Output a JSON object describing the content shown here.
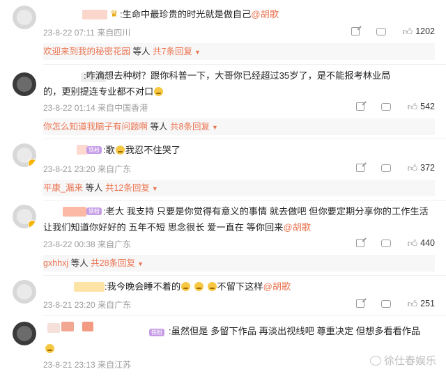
{
  "comments": [
    {
      "text": ":生命中最珍贵的时光就是做自己",
      "mention": "@胡歌",
      "date": "23-8-22 07:11",
      "location": "来自四川",
      "likes": "1202",
      "reply_user": "欢迎来到我的秘密花园",
      "reply_mid": "等人",
      "reply_count": "共7条回复"
    },
    {
      "text_line1": ":咋滴想去种树？跟你科普一下，大哥你已经超过35岁了，是不能报考林业局",
      "text_line2": "的，更别提连专业都不对口",
      "date": "23-8-22 01:14",
      "location": "来自中国香港",
      "likes": "542",
      "reply_user": "你怎么知道我脑子有问题啊",
      "reply_mid": "等人",
      "reply_count": "共8条回复"
    },
    {
      "text_a": ":歌",
      "text_b": "我忍不住哭了",
      "date": "23-8-21 23:20",
      "location": "来自广东",
      "likes": "372",
      "reply_user": "平康_漏来",
      "reply_mid": "等人",
      "reply_count": "共12条回复"
    },
    {
      "text_line1": ":老大 我支持 只要是你觉得有意义的事情 就去做吧 但你要定期分享你的工作生活",
      "text_line2": "让我们知道你好好的  五年不短 思念很长 爱一直在 等你回来",
      "mention": "@胡歌",
      "date": "23-8-22 00:38",
      "location": "来自广东",
      "likes": "440",
      "reply_user": "gxhhxj",
      "reply_mid": "等人",
      "reply_count": "共28条回复"
    },
    {
      "text_a": ":我今晚会睡不着的",
      "text_b": "不留下这样",
      "mention": "@胡歌",
      "date": "23-8-21 23:20",
      "location": "来自广东",
      "likes": "251"
    },
    {
      "text_line1": ":虽然但是 多留下作品 再淡出视线吧 尊重决定 但想多看看作品",
      "date": "23-8-21 23:13",
      "location": "来自江苏"
    }
  ],
  "watermark": "徐仕春娱乐",
  "vip_label": "铁粉",
  "colors": {
    "accent": "#eb7350",
    "meta": "#9b9b9b",
    "reply_bg": "#f7f7f7"
  }
}
